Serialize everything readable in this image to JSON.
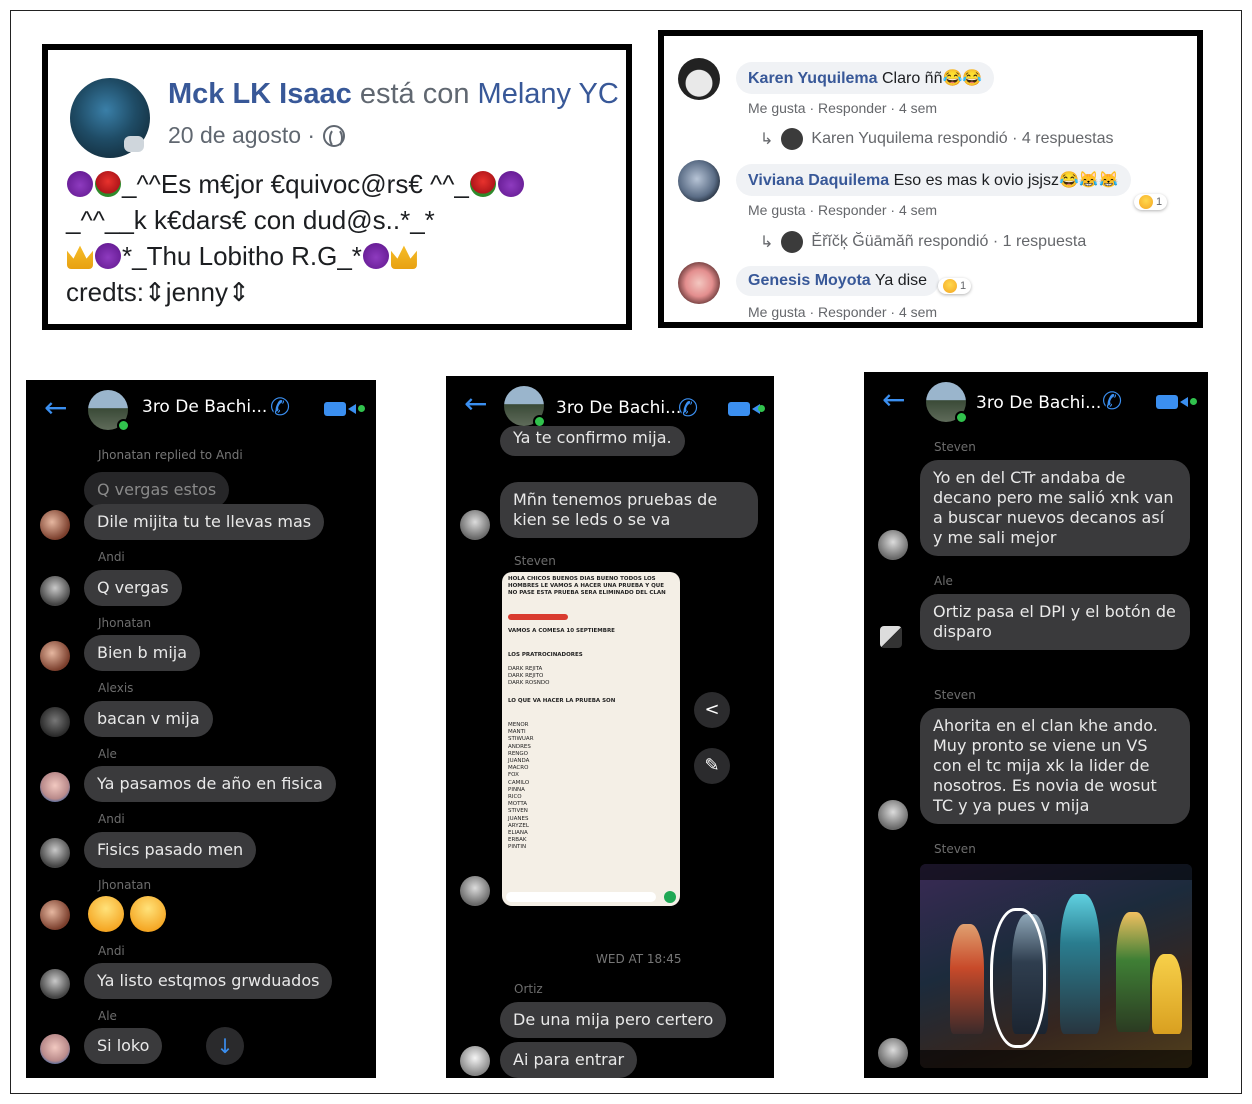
{
  "fb_post": {
    "author": "Mck LK Isaac",
    "with_text": "está con",
    "tagged": "Melany YC",
    "date": "20 de agosto ·",
    "line1": "_^^Es m€jor €quivoc@rs€ ^^_",
    "line2": "_^^__k k€dars€ con dud@s..*_*",
    "line3": "*_Thu Lobitho R.G_*",
    "line4": "credts:⇕jenny⇕"
  },
  "fb_comments": {
    "items": [
      {
        "author": "Karen Yuquilema",
        "text": "Claro ññ😂😂",
        "actions": "Me gusta · Responder · 4 sem",
        "reply": "Karen Yuquilema respondió · 4 respuestas"
      },
      {
        "author": "Viviana Daquilema",
        "text": "Eso es mas k ovio jsjsz😂😹😹",
        "actions": "Me gusta · Responder · 4 sem",
        "reply": "Ěřĭčķ Ğüāmăñ respondió · 1 respuesta",
        "reactions": "1"
      },
      {
        "author": "Genesis Moyota",
        "text": "Ya dise",
        "actions": "Me gusta · Responder · 4 sem",
        "reactions": "1"
      }
    ]
  },
  "phone1": {
    "group": "3ro De Bachi...",
    "replied": "Jhonatan replied to Andi",
    "quoted": "Q vergas estos",
    "msgs": [
      {
        "sender": "",
        "text": "Dile mijita tu te llevas mas"
      },
      {
        "sender": "Andi",
        "text": "Q vergas"
      },
      {
        "sender": "Jhonatan",
        "text": "Bien b mija"
      },
      {
        "sender": "Alexis",
        "text": "bacan v mija"
      },
      {
        "sender": "Ale",
        "text": "Ya pasamos de año en fisica"
      },
      {
        "sender": "Andi",
        "text": "Fisics pasado men"
      },
      {
        "sender": "Jhonatan",
        "text": ""
      },
      {
        "sender": "Andi",
        "text": "Ya listo  estqmos grwduados"
      },
      {
        "sender": "Ale",
        "text": "Si loko"
      }
    ]
  },
  "phone2": {
    "group": "3ro De Bachi...",
    "top_msg": "Ya te confirmo mija.",
    "msg1": "Mñn tenemos pruebas  de kien se leds o se va",
    "sender_steven": "Steven",
    "time": "WED AT 18:45",
    "sender_ortiz": "Ortiz",
    "msg2": "De una mija pero certero",
    "msg3": "Ai para entrar",
    "shared": {
      "header": "HOLA CHICOS BUENOS DIAS BUENO TODOS LOS HOMBRES LE VAMOS A HACER UNA PRUEBA Y QUE NO PASE ESTA PRUEBA SERA ELIMINADO DEL CLAN",
      "start": "VAMOS A COMESA 10 SEPTIEMBRE",
      "sponsors_title": "LOS PRATROCINADORES",
      "sponsors": [
        "DARK REJITA",
        "DARK REJITO",
        "DARK ROSNDO"
      ],
      "test_title": "LO QUE VA HACER LA PRUEBA SON",
      "names": [
        "MENOR",
        "MANTI",
        "STIWUAR",
        "ANDRES",
        "RENGO",
        "JUANDA",
        "MACRO",
        "FOX",
        "CAMILO",
        "PINNA",
        "RICO",
        "MOTTA",
        "STIVEN",
        "JUANES",
        "ARYZEL",
        "ELIANA",
        "ERBAK",
        "PINTIN"
      ]
    }
  },
  "phone3": {
    "group": "3ro De Bachi...",
    "s1": "Steven",
    "m1": "Yo en del CTr andaba de decano pero  me salió xnk van a buscar nuevos decanos así y me sali mejor",
    "s2": "Ale",
    "m2": "Ortiz pasa el DPI y el botón de disparo",
    "s3": "Steven",
    "m3": "Ahorita en el clan khe ando. Muy pronto se viene un VS con el tc mija xk la lider de nosotros. Es novia de wosut TC y ya pues v mija",
    "s4": "Steven"
  }
}
